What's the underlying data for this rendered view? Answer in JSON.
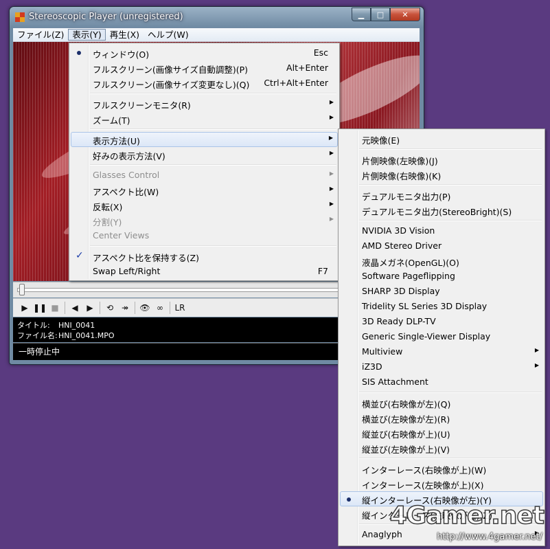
{
  "window": {
    "title": "Stereoscopic Player (unregistered)",
    "close_glyph": "✕",
    "min_glyph": "▁",
    "max_glyph": "□"
  },
  "menubar": [
    {
      "label": "ファイル(Z)"
    },
    {
      "label": "表示(Y)",
      "active": true
    },
    {
      "label": "再生(X)"
    },
    {
      "label": "ヘルプ(W)"
    }
  ],
  "view_menu": {
    "items": [
      {
        "label": "ウィンドウ(O)",
        "accel": "Esc",
        "mark": "radio"
      },
      {
        "label": "フルスクリーン(画像サイズ自動調整)(P)",
        "accel": "Alt+Enter"
      },
      {
        "label": "フルスクリーン(画像サイズ変更なし)(Q)",
        "accel": "Ctrl+Alt+Enter"
      },
      {
        "separator": true
      },
      {
        "label": "フルスクリーンモニタ(R)",
        "submenu": true
      },
      {
        "label": "ズーム(T)",
        "submenu": true
      },
      {
        "separator": true
      },
      {
        "label": "表示方法(U)",
        "submenu": true,
        "highlighted": true
      },
      {
        "label": "好みの表示方法(V)",
        "submenu": true
      },
      {
        "separator": true
      },
      {
        "label": "Glasses Control",
        "submenu": true,
        "disabled": true
      },
      {
        "label": "アスペクト比(W)",
        "submenu": true
      },
      {
        "label": "反転(X)",
        "submenu": true
      },
      {
        "label": "分割(Y)",
        "submenu": true,
        "disabled": true
      },
      {
        "label": "Center Views",
        "disabled": true
      },
      {
        "separator": true
      },
      {
        "label": "アスペクト比を保持する(Z)",
        "mark": "check"
      },
      {
        "label": "Swap Left/Right",
        "accel": "F7"
      }
    ]
  },
  "display_method_menu": {
    "items": [
      {
        "label": "元映像(E)"
      },
      {
        "separator": true
      },
      {
        "label": "片側映像(左映像)(J)"
      },
      {
        "label": "片側映像(右映像)(K)"
      },
      {
        "separator": true
      },
      {
        "label": "デュアルモニタ出力(P)"
      },
      {
        "label": "デュアルモニタ出力(StereoBright)(S)"
      },
      {
        "separator": true
      },
      {
        "label": "NVIDIA 3D Vision"
      },
      {
        "label": "AMD Stereo Driver"
      },
      {
        "label": "液晶メガネ(OpenGL)(O)"
      },
      {
        "label": "Software Pageflipping"
      },
      {
        "label": "SHARP 3D Display"
      },
      {
        "label": "Tridelity SL Series 3D Display"
      },
      {
        "label": "3D Ready DLP-TV"
      },
      {
        "label": "Generic Single-Viewer Display"
      },
      {
        "label": "Multiview",
        "submenu": true
      },
      {
        "label": "iZ3D",
        "submenu": true
      },
      {
        "label": "SIS Attachment"
      },
      {
        "separator": true
      },
      {
        "label": "横並び(右映像が左)(Q)"
      },
      {
        "label": "横並び(左映像が左)(R)"
      },
      {
        "label": "縦並び(右映像が上)(U)"
      },
      {
        "label": "縦並び(左映像が上)(V)"
      },
      {
        "separator": true
      },
      {
        "label": "インターレース(右映像が上)(W)"
      },
      {
        "label": "インターレース(左映像が上)(X)"
      },
      {
        "label": "縦インターレース(右映像が左)(Y)",
        "mark": "radio",
        "highlighted": true
      },
      {
        "label": "縦インターレース(左映像が左)(Z)"
      },
      {
        "separator": true
      },
      {
        "label": "Anaglyph",
        "submenu": true
      }
    ]
  },
  "controls": [
    {
      "name": "play-button",
      "glyph": "▶"
    },
    {
      "name": "pause-button",
      "glyph": "❚❚"
    },
    {
      "name": "stop-button",
      "glyph": "■",
      "dim": true
    },
    {
      "sep": true
    },
    {
      "name": "previous-button",
      "glyph": "◀"
    },
    {
      "name": "next-button",
      "glyph": "▶"
    },
    {
      "sep": true
    },
    {
      "name": "loop-button",
      "glyph": "⟲"
    },
    {
      "name": "step-button",
      "glyph": "↠"
    },
    {
      "sep": true
    },
    {
      "name": "eye-button",
      "glyph": "👁"
    },
    {
      "name": "glasses-button",
      "glyph": "∞"
    },
    {
      "sep": true
    },
    {
      "name": "stereo-lr-button",
      "glyph": "LR"
    }
  ],
  "info": {
    "title_label": "タイトル:",
    "title_value": "HNI_0041",
    "file_label": "ファイル名:",
    "file_value": "HNI_0041.MPO"
  },
  "status": "一時停止中",
  "watermark": {
    "logo": "4Gamer.net",
    "url": "http://www.4gamer.net/"
  }
}
